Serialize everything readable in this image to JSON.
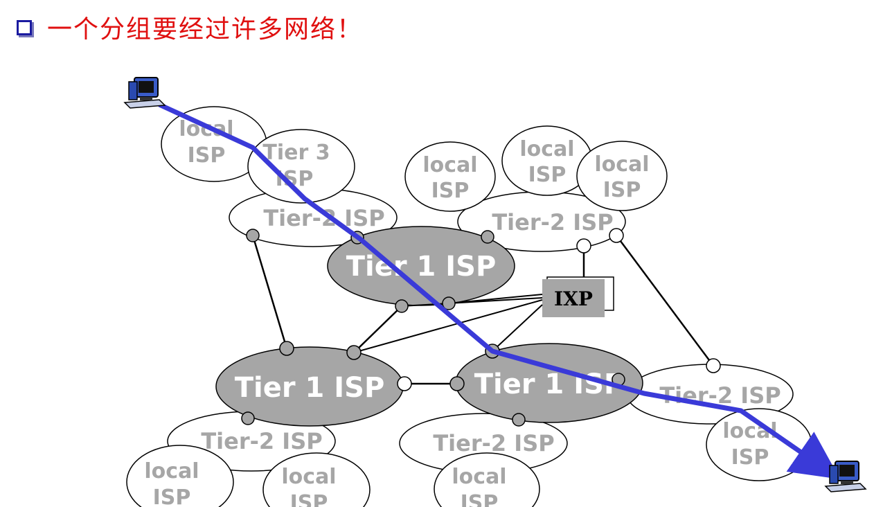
{
  "header": {
    "title": "一个分组要经过许多网络！"
  },
  "diagram": {
    "local_isp_line1": "local",
    "local_isp_line2": "ISP",
    "tier3_line1": "Tier 3",
    "tier3_line2": "ISP",
    "tier2_label": "Tier-2 ISP",
    "tier1_label": "Tier 1 ISP",
    "ixp_label": "IXP",
    "path_color": "#3a3ad8",
    "tier1_fill": "#a6a6a6",
    "icons": [
      "source-computer-icon",
      "destination-computer-icon"
    ]
  }
}
